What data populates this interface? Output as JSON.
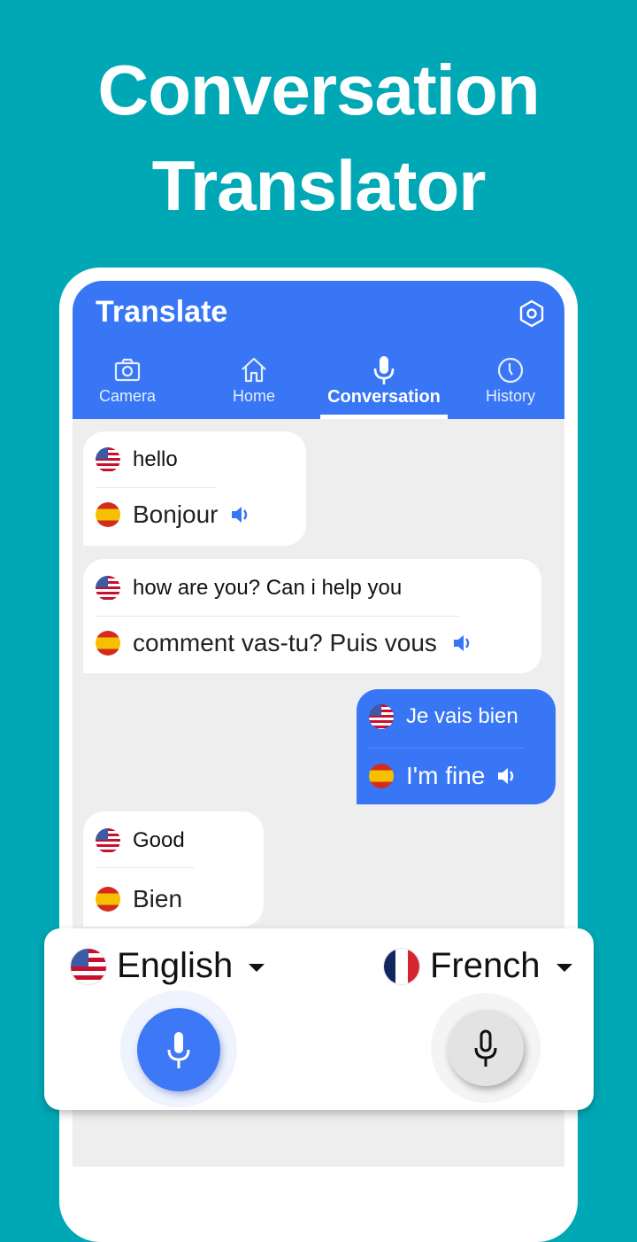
{
  "promo": {
    "line1": "Conversation",
    "line2": "Translator"
  },
  "appbar": {
    "title": "Translate",
    "settings_icon": "settings-hexagon-icon"
  },
  "tabs": [
    {
      "label": "Camera",
      "icon": "camera-icon",
      "active": false
    },
    {
      "label": "Home",
      "icon": "home-icon",
      "active": false
    },
    {
      "label": "Conversation",
      "icon": "microphone-icon",
      "active": true
    },
    {
      "label": "History",
      "icon": "clock-icon",
      "active": false
    }
  ],
  "messages": [
    {
      "side": "left",
      "source_flag": "us-flag",
      "source": "hello",
      "target_flag": "spain-flag",
      "target": "Bonjour",
      "speaker": true
    },
    {
      "side": "left",
      "source_flag": "us-flag",
      "source": "how are you? Can i help you",
      "target_flag": "spain-flag",
      "target": "comment vas-tu? Puis vous",
      "speaker": true
    },
    {
      "side": "right",
      "source_flag": "us-flag",
      "source": "Je vais bien",
      "target_flag": "spain-flag",
      "target": "I'm fine",
      "speaker": true
    },
    {
      "side": "left",
      "source_flag": "us-flag",
      "source": "Good",
      "target_flag": "spain-flag",
      "target": "Bien",
      "speaker": false
    }
  ],
  "panel": {
    "left_language": "English",
    "right_language": "French",
    "left_mic_state": "active",
    "right_mic_state": "idle"
  },
  "colors": {
    "background": "#00a8b5",
    "primary": "#3876f5",
    "screen_bg": "#eeeeee"
  }
}
